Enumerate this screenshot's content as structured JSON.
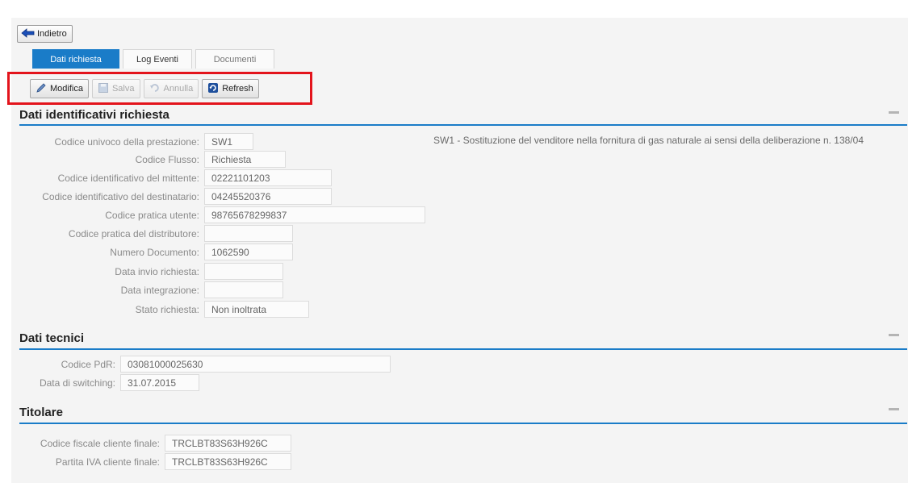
{
  "back_button": {
    "label": "Indietro",
    "icon": "arrow-left-icon"
  },
  "tabs": [
    {
      "label": "Dati richiesta",
      "active": true
    },
    {
      "label": "Log Eventi",
      "active": false
    },
    {
      "label": "Documenti",
      "active": false
    }
  ],
  "toolbar": {
    "modifica": "Modifica",
    "salva": "Salva",
    "annulla": "Annulla",
    "refresh": "Refresh"
  },
  "sections": {
    "dati_identificativi": {
      "title": "Dati identificativi richiesta",
      "fields": [
        {
          "label": "Codice univoco della prestazione:",
          "value": "SW1"
        },
        {
          "label": "Codice Flusso:",
          "value": "Richiesta"
        },
        {
          "label": "Codice identificativo del mittente:",
          "value": "02221101203"
        },
        {
          "label": "Codice identificativo del destinatario:",
          "value": "04245520376"
        },
        {
          "label": "Codice pratica utente:",
          "value": "98765678299837"
        },
        {
          "label": "Codice pratica del distributore:",
          "value": ""
        },
        {
          "label": "Numero Documento:",
          "value": "1062590"
        },
        {
          "label": "Data invio richiesta:",
          "value": ""
        },
        {
          "label": "Data integrazione:",
          "value": ""
        },
        {
          "label": "Stato richiesta:",
          "value": "Non inoltrata"
        }
      ],
      "description": "SW1 - Sostituzione del venditore nella fornitura di gas naturale ai sensi della deliberazione n. 138/04"
    },
    "dati_tecnici": {
      "title": "Dati tecnici",
      "fields": [
        {
          "label": "Codice PdR:",
          "value": "03081000025630"
        },
        {
          "label": "Data di switching:",
          "value": "31.07.2015"
        }
      ]
    },
    "titolare": {
      "title": "Titolare",
      "fields": [
        {
          "label": "Codice fiscale cliente finale:",
          "value": "TRCLBT83S63H926C"
        },
        {
          "label": "Partita IVA cliente finale:",
          "value": "TRCLBT83S63H926C"
        }
      ]
    }
  },
  "colors": {
    "accent": "#1a7cc8",
    "highlight": "#e3141c",
    "panel_bg": "#f4f4f4"
  }
}
